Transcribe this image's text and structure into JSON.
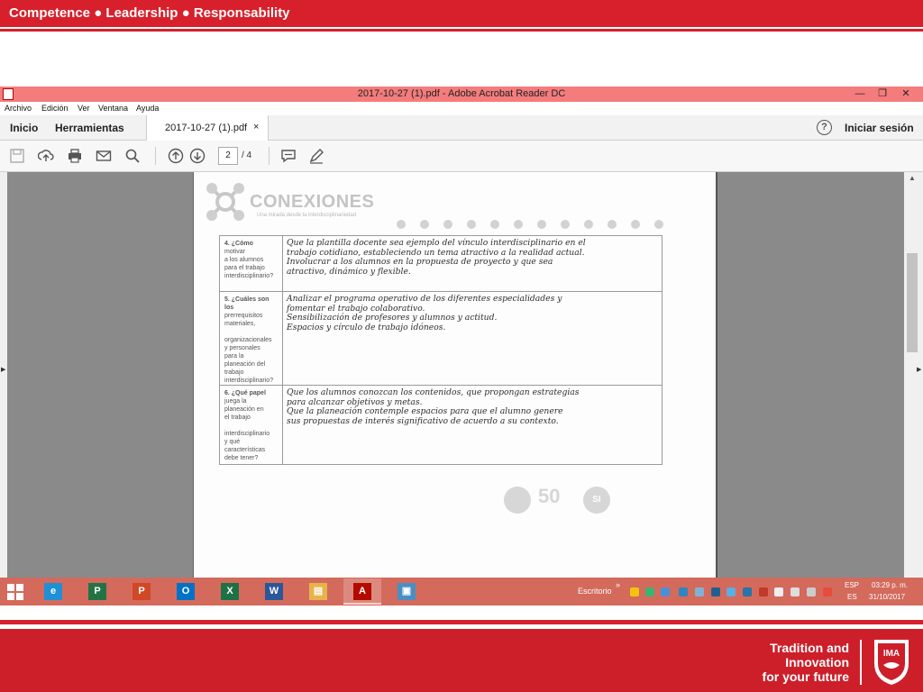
{
  "slide": {
    "tagline": "Competence ● Leadership ● Responsability",
    "footer_lines": [
      "Tradition and",
      "Innovation",
      "for your future"
    ],
    "logo_text": "IMA"
  },
  "window": {
    "title": "2017-10-27 (1).pdf - Adobe Acrobat Reader DC",
    "menu": [
      "Archivo",
      "Edición",
      "Ver",
      "Ventana",
      "Ayuda"
    ],
    "nav": {
      "home": "Inicio",
      "tools": "Herramientas"
    },
    "doc_tab": {
      "label": "2017-10-27 (1).pdf",
      "close": "×"
    },
    "help": "?",
    "signin": "Iniciar sesión"
  },
  "toolbar": {
    "icons": [
      "save-icon",
      "upload-icon",
      "print-icon",
      "mail-icon",
      "search-icon",
      "page-up-icon",
      "page-down-icon",
      "comment-icon",
      "pen-icon"
    ],
    "page_current": "2",
    "page_total": "/ 4"
  },
  "document": {
    "logo_title": "CONEXIONES",
    "logo_subtitle": "Una mirada desde la interdisciplinariedad",
    "rows": [
      {
        "question": [
          "4. ¿Cómo",
          "motivar",
          "a los alumnos",
          "para el trabajo",
          "interdisciplinario?"
        ],
        "answer": [
          "Que la plantilla docente sea ejemplo del vínculo interdisciplinario en el",
          "trabajo cotidiano, estableciendo un tema atractivo a la realidad actual.",
          "Involucrar a los alumnos en la propuesta de proyecto y que sea",
          "atractivo, dinámico y flexible."
        ]
      },
      {
        "question": [
          "5. ¿Cuáles son los",
          "prerrequisitos",
          "materiales,",
          "",
          "organizacionales",
          "y personales",
          "para la",
          "planeación del",
          "trabajo",
          "interdisciplinario?"
        ],
        "answer": [
          "Analizar el programa operativo de los diferentes especialidades y",
          "fomentar el trabajo colaborativo.",
          "Sensibilización de profesores y alumnos y actitud.",
          "Espacios y círculo de trabajo idóneos."
        ]
      },
      {
        "question": [
          "6. ¿Qué papel",
          "juega la",
          "planeación en",
          "el trabajo",
          "",
          "interdisciplinario",
          "y qué",
          "características",
          "debe tener?"
        ],
        "answer": [
          "Que los alumnos conozcan los contenidos, que propongan estrategias",
          "para alcanzar objetivos y metas.",
          "Que la planeación contemple espacios para que el alumno genere",
          "sus propuestas de interés significativo de acuerdo a su contexto."
        ]
      }
    ],
    "seal_fifty": "50",
    "seal_si": "SI"
  },
  "taskbar": {
    "apps": [
      {
        "name": "ie",
        "glyph": "e",
        "color": "#1e90d6"
      },
      {
        "name": "project",
        "glyph": "P",
        "color": "#217346"
      },
      {
        "name": "powerpoint",
        "glyph": "P",
        "color": "#d24726"
      },
      {
        "name": "outlook",
        "glyph": "O",
        "color": "#0072c6"
      },
      {
        "name": "excel",
        "glyph": "X",
        "color": "#1e7145"
      },
      {
        "name": "word",
        "glyph": "W",
        "color": "#2b579a"
      },
      {
        "name": "explorer",
        "glyph": "▤",
        "color": "#e8b34a"
      },
      {
        "name": "acrobat",
        "glyph": "A",
        "color": "#b30b00"
      },
      {
        "name": "photos",
        "glyph": "▣",
        "color": "#4a8fc4"
      }
    ],
    "desktop_label": "Escritorio",
    "chevron": "»",
    "lang_top": "ESP",
    "lang_bottom": "ES",
    "time": "03:29 p. m.",
    "date": "31/10/2017"
  },
  "colors": {
    "brand_red": "#d7202b",
    "titlebar": "#f47c7c",
    "taskbar": "#d36a5c"
  }
}
